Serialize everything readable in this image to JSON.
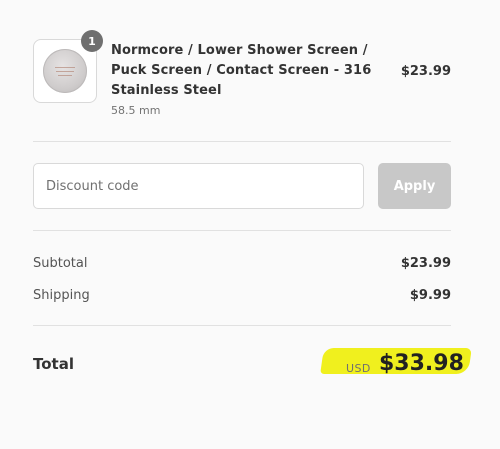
{
  "cart_item": {
    "quantity_badge": "1",
    "title": "Normcore / Lower Shower Screen / Puck Screen / Contact Screen - 316 Stainless Steel",
    "variant": "58.5 mm",
    "price": "$23.99",
    "image_icon": "puck-screen-image"
  },
  "discount": {
    "placeholder": "Discount code",
    "value": "",
    "apply_label": "Apply"
  },
  "summary": {
    "subtotal_label": "Subtotal",
    "subtotal_value": "$23.99",
    "shipping_label": "Shipping",
    "shipping_value": "$9.99"
  },
  "total": {
    "label": "Total",
    "currency": "USD",
    "amount": "$33.98",
    "highlight_color": "#f0f01e"
  }
}
